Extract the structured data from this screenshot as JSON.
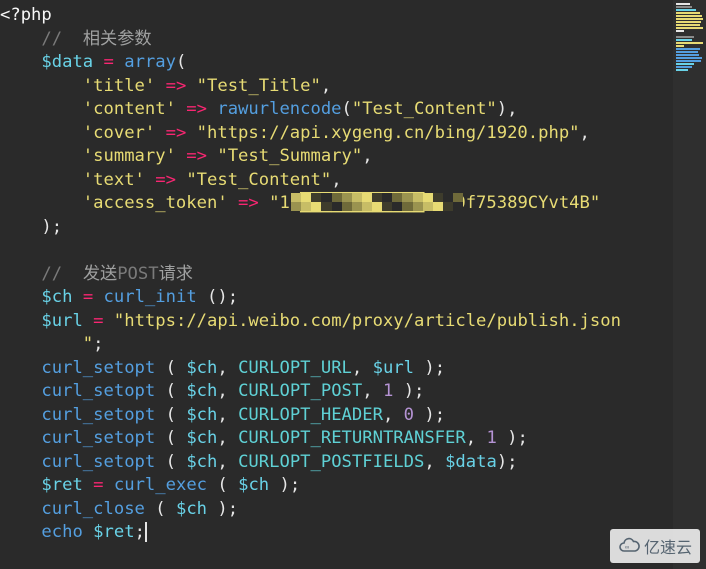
{
  "code": {
    "open_tag": "<?php",
    "comment1_slash": "//",
    "comment1_text": "相关参数",
    "data_var": "$data",
    "eq": "=",
    "array_kw": "array",
    "arrow": "=>",
    "keys": {
      "title": "'title'",
      "content": "'content'",
      "cover": "'cover'",
      "summary": "'summary'",
      "text": "'text'",
      "access_token": "'access_token'"
    },
    "vals": {
      "title": "\"Test_Title\"",
      "content_func": "rawurlencode",
      "content_arg": "\"Test_Content\"",
      "cover": "\"https://api.xygeng.cn/bing/1920.php\"",
      "summary": "\"Test_Summary\"",
      "text": "\"Test_Content\"",
      "access_token": "\"1 ████████████0600f75389CYvt4B\""
    },
    "comment2_slash": "//",
    "comment2_text_a": "发送",
    "comment2_text_b": "POST",
    "comment2_text_c": "请求",
    "ch_var": "$ch",
    "curl_init": "curl_init",
    "url_var": "$url",
    "url_val_a": "\"https://api.weibo.com/proxy/article/publish.json",
    "url_val_b": "\"",
    "curl_setopt": "curl_setopt",
    "opts": {
      "url": "CURLOPT_URL",
      "post": "CURLOPT_POST",
      "header": "CURLOPT_HEADER",
      "returntransfer": "CURLOPT_RETURNTRANSFER",
      "postfields": "CURLOPT_POSTFIELDS"
    },
    "num1": "1",
    "num0": "0",
    "ret_var": "$ret",
    "curl_exec": "curl_exec",
    "curl_close": "curl_close",
    "echo": "echo"
  },
  "watermark": "亿速云"
}
